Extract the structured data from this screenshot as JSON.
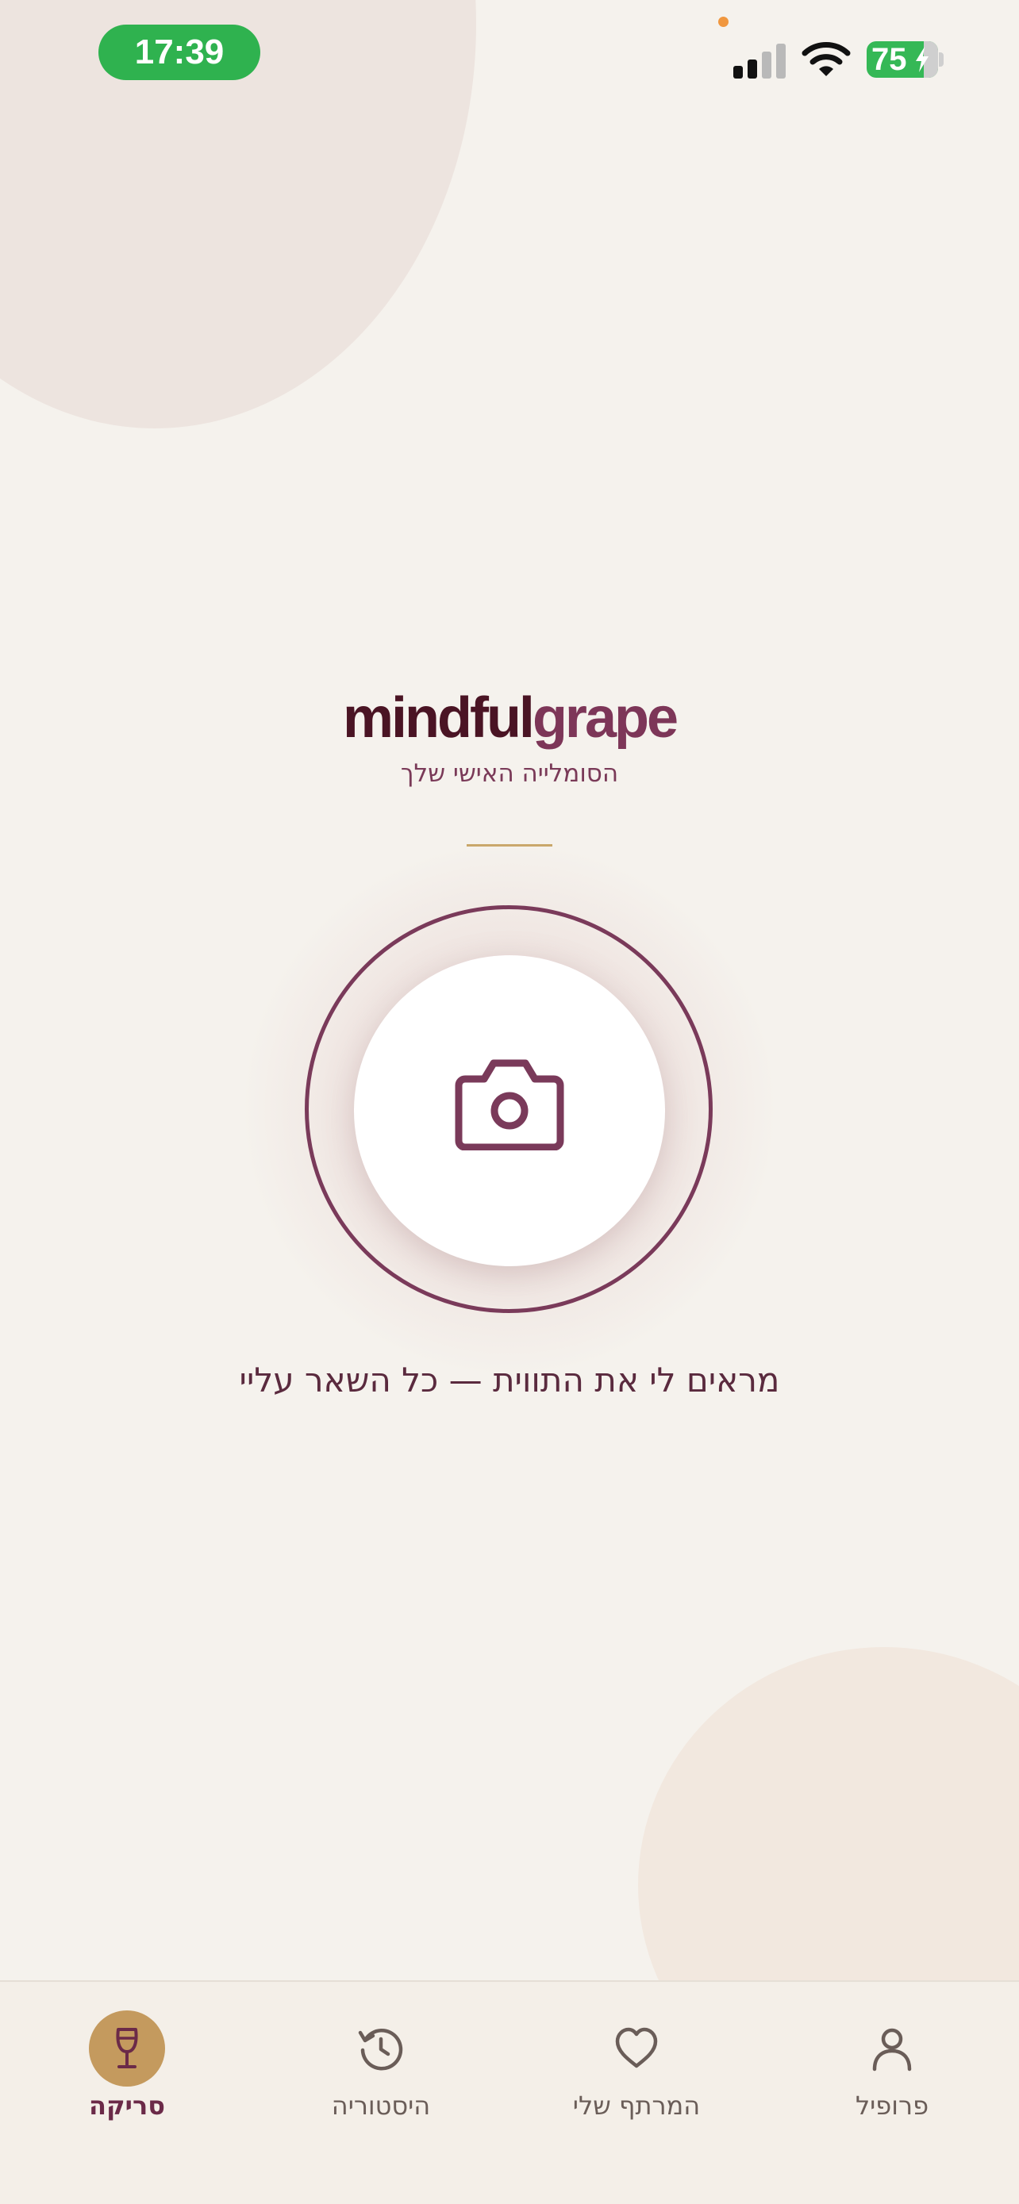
{
  "status_bar": {
    "time": "17:39",
    "battery_level": "75"
  },
  "brand": {
    "name_part1": "mindful",
    "name_part2": "grape",
    "tagline": "הסומלייה האישי שלך"
  },
  "scan": {
    "instruction": "מראים לי את התווית — כל השאר עליי",
    "icon": "camera-icon"
  },
  "nav": {
    "items": [
      {
        "label": "פרופיל",
        "icon": "person-icon",
        "active": false
      },
      {
        "label": "המרתף שלי",
        "icon": "heart-icon",
        "active": false
      },
      {
        "label": "היסטוריה",
        "icon": "history-icon",
        "active": false
      },
      {
        "label": "סריקה",
        "icon": "wine-glass-icon",
        "active": true
      }
    ]
  },
  "colors": {
    "background": "#f5f2ed",
    "brand_dark": "#4a1424",
    "brand_plum": "#7d3658",
    "accent_gold": "#c49a5e",
    "status_green": "#2fb24f"
  }
}
